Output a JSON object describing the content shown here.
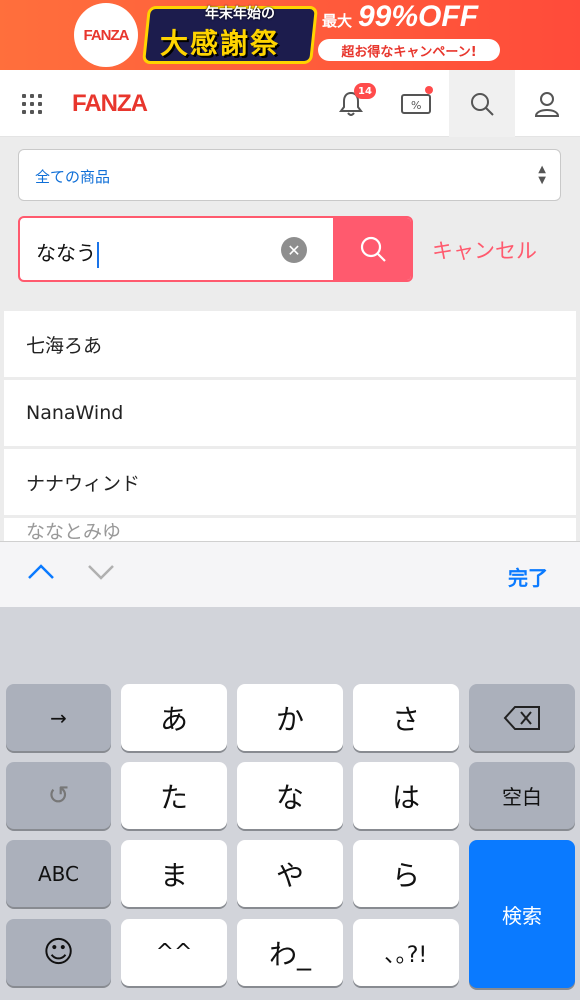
{
  "banner": {
    "logo": "FANZA",
    "top_text": "年末年始の",
    "main_text": "大感謝祭",
    "sub1": "最大",
    "big": "99%OFF",
    "pill": "超お得なキャンペーン!"
  },
  "header": {
    "brand": "FANZA",
    "notification_count": "14",
    "coupon_label": "%"
  },
  "category_select": {
    "value": "全ての商品"
  },
  "search": {
    "value": "ななう",
    "cancel_label": "キャンセル"
  },
  "suggestions": [
    "七海ろあ",
    "NanaWind",
    "ナナウィンド",
    "ななとみゆ"
  ],
  "accessory": {
    "done_label": "完了"
  },
  "keyboard": {
    "arrow": "→",
    "undo": "↺",
    "abc": "ABC",
    "emoji": "☺",
    "space": "空白",
    "search": "検索",
    "keys_row1": [
      "あ",
      "か",
      "さ"
    ],
    "keys_row2": [
      "た",
      "な",
      "は"
    ],
    "keys_row3": [
      "ま",
      "や",
      "ら"
    ],
    "keys_row4": [
      "^^",
      "わ_",
      "､｡?!"
    ]
  },
  "colors": {
    "accent": "#ff5a6e",
    "brand": "#e8362d",
    "link": "#0f6fd7",
    "ios_blue": "#0a7aff"
  }
}
